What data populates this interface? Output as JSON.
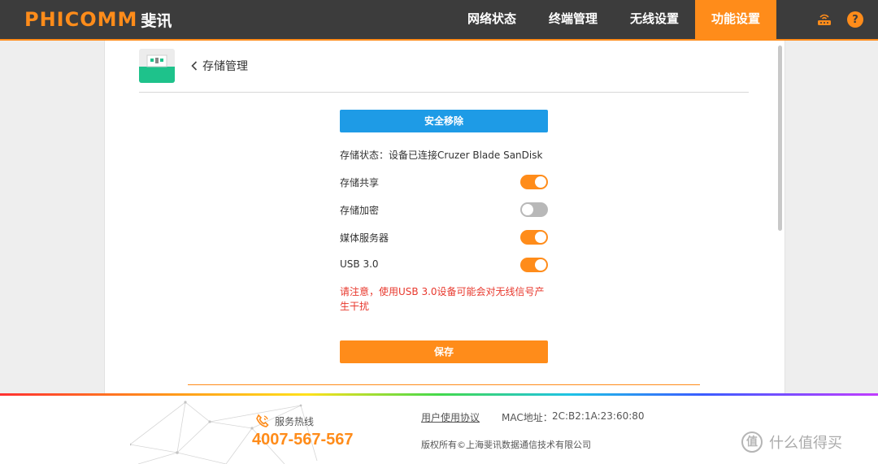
{
  "header": {
    "logo_en": "PHICOMM",
    "logo_cn": "斐讯",
    "nav": [
      {
        "label": "网络状态"
      },
      {
        "label": "终端管理"
      },
      {
        "label": "无线设置"
      },
      {
        "label": "功能设置"
      }
    ],
    "active_nav": "功能设置",
    "help_icon_text": "?",
    "icons": [
      "router-icon",
      "help-icon"
    ]
  },
  "page": {
    "back_icon": "chevron-left-icon",
    "title": "存储管理",
    "app_icon": "usb-storage-icon"
  },
  "storage": {
    "safe_remove_label": "安全移除",
    "status_text": "存储状态：设备已连接Cruzer Blade SanDisk",
    "toggles": [
      {
        "label": "存储共享",
        "on": true
      },
      {
        "label": "存储加密",
        "on": false
      },
      {
        "label": "媒体服务器",
        "on": true
      },
      {
        "label": "USB 3.0",
        "on": true
      }
    ],
    "warning": "请注意，使用USB 3.0设备可能会对无线信号产生干扰",
    "save_label": "保存"
  },
  "footer": {
    "hotline_icon": "phone-icon",
    "hotline_label": "服务热线",
    "hotline_number": "4007-567-567",
    "user_agreement": "用户使用协议",
    "mac_label": "MAC地址：",
    "mac_value": "2C:B2:1A:23:60:80",
    "copyright": "版权所有©上海斐讯数据通信技术有限公司"
  },
  "watermark": {
    "badge": "值",
    "text": "什么值得买"
  },
  "colors": {
    "accent": "#ff8c1a",
    "topbar": "#3c3c3c",
    "blue_button": "#1e9be6",
    "warning": "#e8382d",
    "usb_green": "#1ec28b"
  }
}
